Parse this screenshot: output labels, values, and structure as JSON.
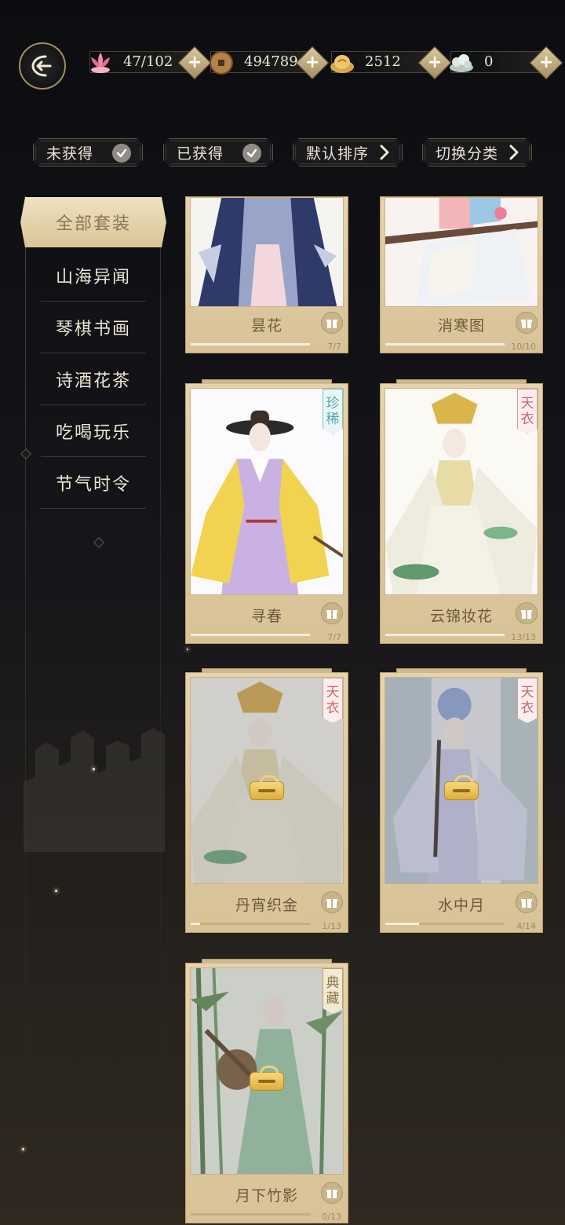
{
  "header": {
    "currencies": [
      {
        "icon": "lotus-icon",
        "value": "47/102"
      },
      {
        "icon": "copper-coin-icon",
        "value": "494789"
      },
      {
        "icon": "gold-ingot-icon",
        "value": "2512"
      },
      {
        "icon": "jade-cloud-icon",
        "value": "0"
      }
    ]
  },
  "filters": [
    {
      "label": "未获得",
      "indicator": "check"
    },
    {
      "label": "已获得",
      "indicator": "check"
    },
    {
      "label": "默认排序",
      "indicator": "arrow"
    },
    {
      "label": "切换分类",
      "indicator": "arrow"
    }
  ],
  "sidebar": {
    "active": "全部套装",
    "items": [
      "山海异闻",
      "琴棋书画",
      "诗酒花茶",
      "吃喝玩乐",
      "节气时令"
    ]
  },
  "cards": [
    {
      "name": "昙花",
      "progress": "7/7",
      "fraction": 1.0,
      "badge": "",
      "locked": false
    },
    {
      "name": "消寒图",
      "progress": "10/10",
      "fraction": 1.0,
      "badge": "",
      "locked": false
    },
    {
      "name": "寻春",
      "progress": "7/7",
      "fraction": 1.0,
      "badge": "珍稀",
      "badge_type": "rare",
      "locked": false
    },
    {
      "name": "云锦妆花",
      "progress": "13/13",
      "fraction": 1.0,
      "badge": "天衣",
      "badge_type": "heaven",
      "locked": false
    },
    {
      "name": "丹宵织金",
      "progress": "1/13",
      "fraction": 0.077,
      "badge": "天衣",
      "badge_type": "heaven",
      "locked": true
    },
    {
      "name": "水中月",
      "progress": "4/14",
      "fraction": 0.286,
      "badge": "天衣",
      "badge_type": "heaven",
      "locked": true
    },
    {
      "name": "月下竹影",
      "progress": "0/13",
      "fraction": 0.0,
      "badge": "典藏",
      "badge_type": "classic",
      "locked": true
    }
  ],
  "colors": {
    "accent_gold": "#d9c496",
    "rare_badge": "#52a6ab",
    "heaven_badge": "#c76666"
  }
}
